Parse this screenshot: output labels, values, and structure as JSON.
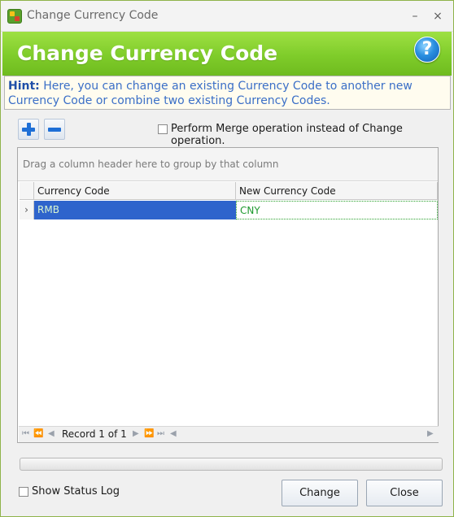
{
  "window": {
    "title": "Change Currency Code",
    "minimize": "–",
    "close": "×"
  },
  "header": {
    "title": "Change Currency Code",
    "help": "?"
  },
  "hint": {
    "label": "Hint:",
    "text": "Here, you can change an existing Currency Code to another new Currency Code or combine two existing Currency Codes."
  },
  "toolbar": {
    "add_icon": "plus-icon",
    "remove_icon": "minus-icon",
    "merge_label": "Perform Merge operation instead of Change operation.",
    "merge_checked": false
  },
  "grid": {
    "group_panel_text": "Drag a column header here to group by that column",
    "columns": [
      "Currency Code",
      "New Currency Code"
    ],
    "rows": [
      {
        "indicator": "›",
        "currency_code": "RMB",
        "new_currency_code": "CNY"
      }
    ],
    "navigator": {
      "record_text": "Record 1 of 1"
    }
  },
  "progress": {
    "value": 0
  },
  "footer": {
    "status_log_label": "Show Status Log",
    "status_log_checked": false,
    "change_label": "Change",
    "close_label": "Close"
  },
  "colors": {
    "header_green": "#7fcc2a",
    "selected_cell": "#2e64cc",
    "new_code_text": "#1e9a2f",
    "hint_text": "#3b6fc7"
  }
}
